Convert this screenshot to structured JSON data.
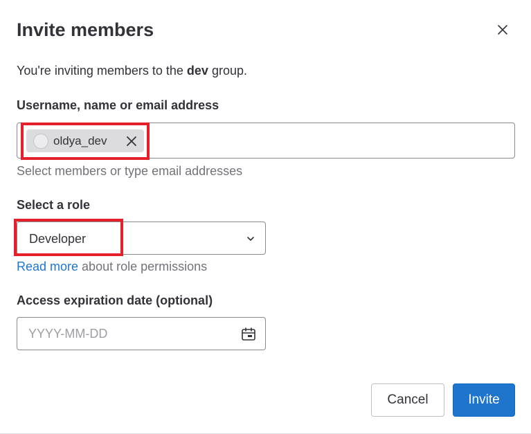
{
  "modal": {
    "title": "Invite members",
    "intro_prefix": "You're inviting members to the ",
    "group_name": "dev",
    "intro_suffix": " group."
  },
  "members": {
    "label": "Username, name or email address",
    "tokens": [
      {
        "name": "oldya_dev"
      }
    ],
    "help_text": "Select members or type email addresses"
  },
  "role": {
    "label": "Select a role",
    "selected": "Developer",
    "link_text": "Read more",
    "help_suffix": " about role permissions"
  },
  "expiration": {
    "label": "Access expiration date (optional)",
    "placeholder": "YYYY-MM-DD",
    "value": ""
  },
  "footer": {
    "cancel_label": "Cancel",
    "invite_label": "Invite"
  },
  "colors": {
    "primary": "#1f75cb",
    "highlight": "#e5202a",
    "text": "#333238",
    "muted": "#737278"
  },
  "icons": {
    "close": "close-icon",
    "token_remove": "close-icon",
    "dropdown": "chevron-down-icon",
    "calendar": "calendar-icon"
  }
}
